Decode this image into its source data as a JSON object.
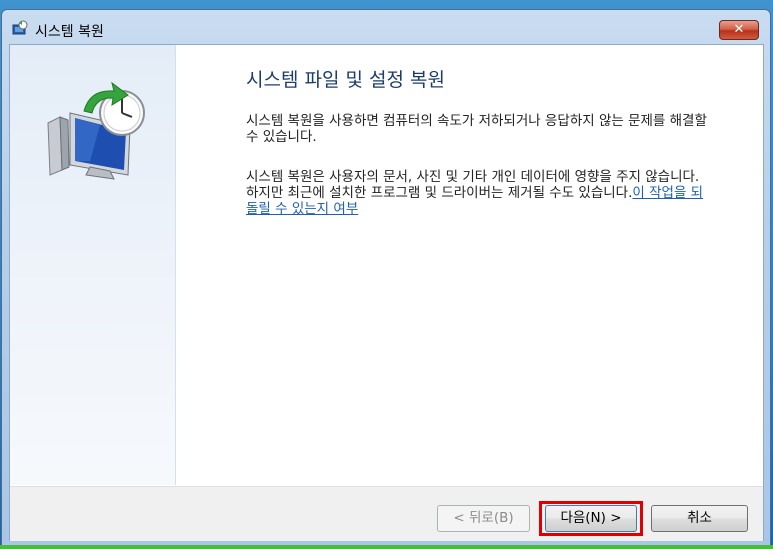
{
  "window": {
    "title": "시스템 복원",
    "close_glyph": "✕"
  },
  "main": {
    "heading": "시스템 파일 및 설정 복원",
    "paragraph1": "시스템 복원을 사용하면 컴퓨터의 속도가 저하되거나 응답하지 않는 문제를 해결할 수 있습니다.",
    "paragraph2": "시스템 복원은 사용자의 문서, 사진 및 기타 개인 데이터에 영향을 주지 않습니다. 하지만 최근에 설치한 프로그램 및 드라이버는 제거될 수도 있습니다.",
    "link": "이 작업을 되돌릴 수 있는지 여부"
  },
  "footer": {
    "back_label": "< 뒤로(B)",
    "next_label": "다음(N) >",
    "cancel_label": "취소"
  },
  "colors": {
    "heading": "#1b3d6b",
    "link": "#1f61b0",
    "highlight": "#e00000"
  },
  "icons": {
    "title": "system-restore-icon",
    "illustration": "monitor-clock-restore-icon"
  }
}
